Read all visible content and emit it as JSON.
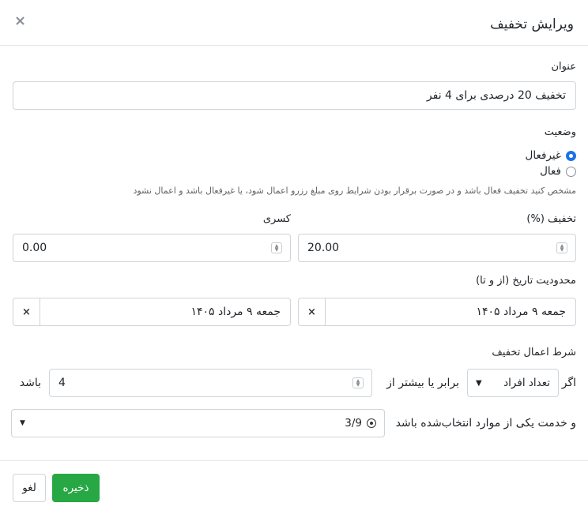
{
  "modal": {
    "title": "ویرایش تخفیف",
    "close_icon": "×"
  },
  "fields": {
    "title_label": "عنوان",
    "title_value": "تخفیف 20 درصدی برای 4 نفر",
    "status_label": "وضعیت",
    "status_options": [
      {
        "label": "غیرفعال",
        "selected": true
      },
      {
        "label": "فعال",
        "selected": false
      }
    ],
    "status_help": "مشخص کنید تخفیف فعال باشد و در صورت برقرار بودن شرایط روی مبلغ رزرو اعمال شود، یا غیرفعال باشد و اعمال نشود",
    "discount_label": "تخفیف (%)",
    "discount_value": "20.00",
    "fraction_label": "کسری",
    "fraction_value": "0.00",
    "date_label": "محدودیت تاریخ (از و تا)",
    "date_from": "جمعه ۹ مرداد ۱۴۰۵",
    "date_to": "جمعه ۹ مرداد ۱۴۰۵",
    "date_clear_icon": "×"
  },
  "condition": {
    "label": "شرط اعمال تخفیف",
    "if_text": "اگر",
    "subject_select": "تعداد افراد",
    "operator_text": "برابر یا بیشتر از",
    "amount_value": "4",
    "tail_text": "باشد",
    "service_text": "و خدمت یکی از موارد انتخاب‌شده باشد",
    "service_select_value": "3/9",
    "service_icon": "target-icon"
  },
  "footer": {
    "save_label": "ذخیره",
    "cancel_label": "لغو"
  },
  "colors": {
    "accent": "#1a73e8",
    "save": "#28a745",
    "border": "#ced4da"
  }
}
